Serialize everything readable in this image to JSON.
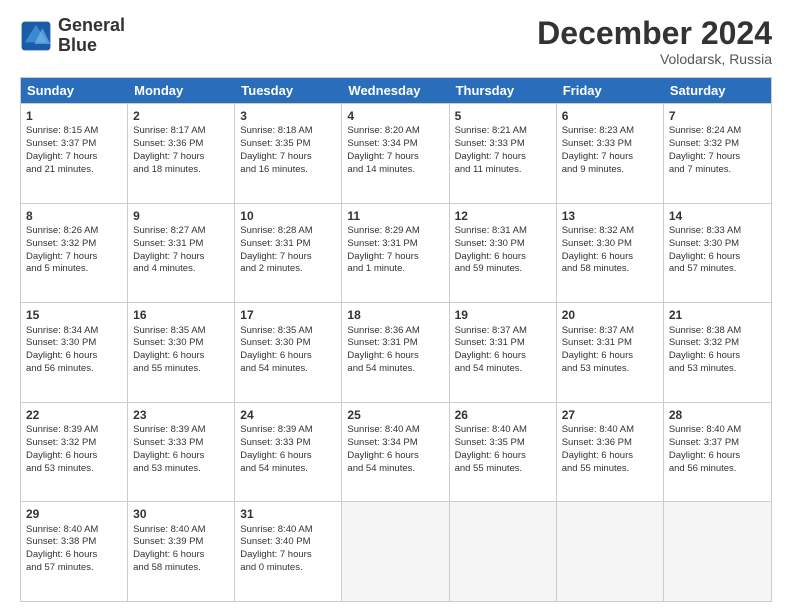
{
  "logo": {
    "line1": "General",
    "line2": "Blue"
  },
  "title": "December 2024",
  "subtitle": "Volodarsk, Russia",
  "header_days": [
    "Sunday",
    "Monday",
    "Tuesday",
    "Wednesday",
    "Thursday",
    "Friday",
    "Saturday"
  ],
  "weeks": [
    [
      {
        "day": "1",
        "lines": [
          "Sunrise: 8:15 AM",
          "Sunset: 3:37 PM",
          "Daylight: 7 hours",
          "and 21 minutes."
        ]
      },
      {
        "day": "2",
        "lines": [
          "Sunrise: 8:17 AM",
          "Sunset: 3:36 PM",
          "Daylight: 7 hours",
          "and 18 minutes."
        ]
      },
      {
        "day": "3",
        "lines": [
          "Sunrise: 8:18 AM",
          "Sunset: 3:35 PM",
          "Daylight: 7 hours",
          "and 16 minutes."
        ]
      },
      {
        "day": "4",
        "lines": [
          "Sunrise: 8:20 AM",
          "Sunset: 3:34 PM",
          "Daylight: 7 hours",
          "and 14 minutes."
        ]
      },
      {
        "day": "5",
        "lines": [
          "Sunrise: 8:21 AM",
          "Sunset: 3:33 PM",
          "Daylight: 7 hours",
          "and 11 minutes."
        ]
      },
      {
        "day": "6",
        "lines": [
          "Sunrise: 8:23 AM",
          "Sunset: 3:33 PM",
          "Daylight: 7 hours",
          "and 9 minutes."
        ]
      },
      {
        "day": "7",
        "lines": [
          "Sunrise: 8:24 AM",
          "Sunset: 3:32 PM",
          "Daylight: 7 hours",
          "and 7 minutes."
        ]
      }
    ],
    [
      {
        "day": "8",
        "lines": [
          "Sunrise: 8:26 AM",
          "Sunset: 3:32 PM",
          "Daylight: 7 hours",
          "and 5 minutes."
        ]
      },
      {
        "day": "9",
        "lines": [
          "Sunrise: 8:27 AM",
          "Sunset: 3:31 PM",
          "Daylight: 7 hours",
          "and 4 minutes."
        ]
      },
      {
        "day": "10",
        "lines": [
          "Sunrise: 8:28 AM",
          "Sunset: 3:31 PM",
          "Daylight: 7 hours",
          "and 2 minutes."
        ]
      },
      {
        "day": "11",
        "lines": [
          "Sunrise: 8:29 AM",
          "Sunset: 3:31 PM",
          "Daylight: 7 hours",
          "and 1 minute."
        ]
      },
      {
        "day": "12",
        "lines": [
          "Sunrise: 8:31 AM",
          "Sunset: 3:30 PM",
          "Daylight: 6 hours",
          "and 59 minutes."
        ]
      },
      {
        "day": "13",
        "lines": [
          "Sunrise: 8:32 AM",
          "Sunset: 3:30 PM",
          "Daylight: 6 hours",
          "and 58 minutes."
        ]
      },
      {
        "day": "14",
        "lines": [
          "Sunrise: 8:33 AM",
          "Sunset: 3:30 PM",
          "Daylight: 6 hours",
          "and 57 minutes."
        ]
      }
    ],
    [
      {
        "day": "15",
        "lines": [
          "Sunrise: 8:34 AM",
          "Sunset: 3:30 PM",
          "Daylight: 6 hours",
          "and 56 minutes."
        ]
      },
      {
        "day": "16",
        "lines": [
          "Sunrise: 8:35 AM",
          "Sunset: 3:30 PM",
          "Daylight: 6 hours",
          "and 55 minutes."
        ]
      },
      {
        "day": "17",
        "lines": [
          "Sunrise: 8:35 AM",
          "Sunset: 3:30 PM",
          "Daylight: 6 hours",
          "and 54 minutes."
        ]
      },
      {
        "day": "18",
        "lines": [
          "Sunrise: 8:36 AM",
          "Sunset: 3:31 PM",
          "Daylight: 6 hours",
          "and 54 minutes."
        ]
      },
      {
        "day": "19",
        "lines": [
          "Sunrise: 8:37 AM",
          "Sunset: 3:31 PM",
          "Daylight: 6 hours",
          "and 54 minutes."
        ]
      },
      {
        "day": "20",
        "lines": [
          "Sunrise: 8:37 AM",
          "Sunset: 3:31 PM",
          "Daylight: 6 hours",
          "and 53 minutes."
        ]
      },
      {
        "day": "21",
        "lines": [
          "Sunrise: 8:38 AM",
          "Sunset: 3:32 PM",
          "Daylight: 6 hours",
          "and 53 minutes."
        ]
      }
    ],
    [
      {
        "day": "22",
        "lines": [
          "Sunrise: 8:39 AM",
          "Sunset: 3:32 PM",
          "Daylight: 6 hours",
          "and 53 minutes."
        ]
      },
      {
        "day": "23",
        "lines": [
          "Sunrise: 8:39 AM",
          "Sunset: 3:33 PM",
          "Daylight: 6 hours",
          "and 53 minutes."
        ]
      },
      {
        "day": "24",
        "lines": [
          "Sunrise: 8:39 AM",
          "Sunset: 3:33 PM",
          "Daylight: 6 hours",
          "and 54 minutes."
        ]
      },
      {
        "day": "25",
        "lines": [
          "Sunrise: 8:40 AM",
          "Sunset: 3:34 PM",
          "Daylight: 6 hours",
          "and 54 minutes."
        ]
      },
      {
        "day": "26",
        "lines": [
          "Sunrise: 8:40 AM",
          "Sunset: 3:35 PM",
          "Daylight: 6 hours",
          "and 55 minutes."
        ]
      },
      {
        "day": "27",
        "lines": [
          "Sunrise: 8:40 AM",
          "Sunset: 3:36 PM",
          "Daylight: 6 hours",
          "and 55 minutes."
        ]
      },
      {
        "day": "28",
        "lines": [
          "Sunrise: 8:40 AM",
          "Sunset: 3:37 PM",
          "Daylight: 6 hours",
          "and 56 minutes."
        ]
      }
    ],
    [
      {
        "day": "29",
        "lines": [
          "Sunrise: 8:40 AM",
          "Sunset: 3:38 PM",
          "Daylight: 6 hours",
          "and 57 minutes."
        ]
      },
      {
        "day": "30",
        "lines": [
          "Sunrise: 8:40 AM",
          "Sunset: 3:39 PM",
          "Daylight: 6 hours",
          "and 58 minutes."
        ]
      },
      {
        "day": "31",
        "lines": [
          "Sunrise: 8:40 AM",
          "Sunset: 3:40 PM",
          "Daylight: 7 hours",
          "and 0 minutes."
        ]
      },
      {
        "day": "",
        "lines": []
      },
      {
        "day": "",
        "lines": []
      },
      {
        "day": "",
        "lines": []
      },
      {
        "day": "",
        "lines": []
      }
    ]
  ]
}
